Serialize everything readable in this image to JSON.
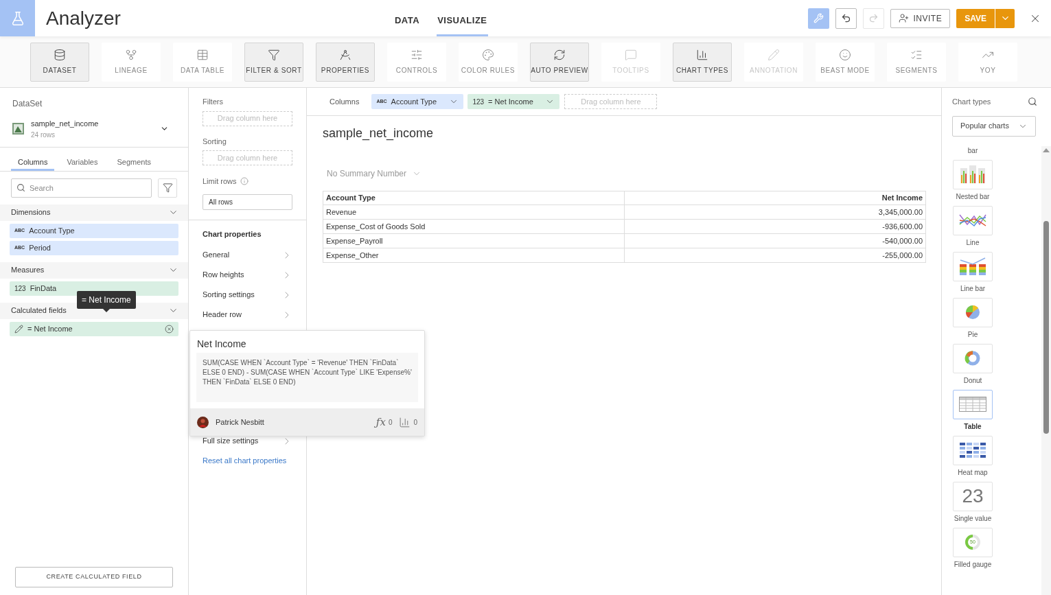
{
  "app": {
    "title": "Analyzer"
  },
  "nav_tabs": [
    {
      "label": "DATA",
      "selected": false
    },
    {
      "label": "VISUALIZE",
      "selected": true
    }
  ],
  "header_actions": {
    "tools_active": true,
    "redo_disabled": true,
    "invite": "INVITE",
    "save": "SAVE"
  },
  "toolbar": [
    {
      "label": "DATASET",
      "active": true,
      "disabled": false
    },
    {
      "label": "LINEAGE",
      "active": false,
      "disabled": false
    },
    {
      "label": "DATA TABLE",
      "active": false,
      "disabled": false
    },
    {
      "label": "FILTER & SORT",
      "active": true,
      "disabled": false
    },
    {
      "label": "PROPERTIES",
      "active": true,
      "disabled": false
    },
    {
      "label": "CONTROLS",
      "active": false,
      "disabled": false
    },
    {
      "label": "COLOR RULES",
      "active": false,
      "disabled": false
    },
    {
      "label": "AUTO PREVIEW",
      "active": true,
      "disabled": false
    },
    {
      "label": "TOOLTIPS",
      "active": false,
      "disabled": true
    },
    {
      "label": "CHART TYPES",
      "active": true,
      "disabled": false
    },
    {
      "label": "ANNOTATION",
      "active": false,
      "disabled": true
    },
    {
      "label": "BEAST MODE",
      "active": false,
      "disabled": false
    },
    {
      "label": "SEGMENTS",
      "active": false,
      "disabled": false
    },
    {
      "label": "YOY",
      "active": false,
      "disabled": false
    }
  ],
  "dataset_panel": {
    "heading": "DataSet",
    "name": "sample_net_income",
    "rows": "24 rows",
    "tabs": [
      {
        "label": "Columns",
        "selected": true
      },
      {
        "label": "Variables",
        "selected": false
      },
      {
        "label": "Segments",
        "selected": false
      }
    ],
    "search": {
      "placeholder": "Search"
    },
    "sections": [
      {
        "title": "Dimensions",
        "items": [
          {
            "kind": "dimension",
            "type_label": "ABC",
            "name": "Account Type"
          },
          {
            "kind": "dimension",
            "type_label": "ABC",
            "name": "Period"
          }
        ]
      },
      {
        "title": "Measures",
        "items": [
          {
            "kind": "measure",
            "type_label": "123",
            "name": "FinData"
          }
        ]
      },
      {
        "title": "Calculated fields",
        "items": [
          {
            "kind": "calculated",
            "name": "= Net Income"
          }
        ]
      }
    ],
    "create_button": "CREATE CALCULATED FIELD"
  },
  "hover_tooltip": "= Net Income",
  "filters_panel": {
    "filters_label": "Filters",
    "filters_drop": "Drag column here",
    "sorting_label": "Sorting",
    "sorting_drop": "Drag column here",
    "limit_label": "Limit rows",
    "limit_value": "All rows",
    "chart_properties_title": "Chart properties",
    "properties": [
      "General",
      "Row heights",
      "Sorting settings",
      "Header row",
      "Full size settings"
    ],
    "reset": "Reset all chart properties"
  },
  "popover": {
    "title": "Net Income",
    "formula": "SUM(CASE WHEN `Account Type` = 'Revenue' THEN `FinData` ELSE 0 END) - SUM(CASE WHEN `Account Type` LIKE 'Expense%' THEN `FinData` ELSE 0 END)",
    "author": "Patrick Nesbitt",
    "function_symbol": "ƒx",
    "formula_count": "0",
    "chart_count": "0"
  },
  "columns_bar": {
    "label": "Columns",
    "pills": [
      {
        "kind": "dimension",
        "type_label": "ABC",
        "name": "Account Type"
      },
      {
        "kind": "measure",
        "type_label": "123",
        "name": "= Net Income"
      }
    ],
    "drop": "Drag column here"
  },
  "chart": {
    "title": "sample_net_income",
    "summary": "No Summary Number",
    "table": {
      "columns": [
        "Account Type",
        "Net Income"
      ],
      "rows": [
        [
          "Revenue",
          "3,345,000.00"
        ],
        [
          "Expense_Cost of Goods Sold",
          "-936,600.00"
        ],
        [
          "Expense_Payroll",
          "-540,000.00"
        ],
        [
          "Expense_Other",
          "-255,000.00"
        ]
      ]
    }
  },
  "chart_types": {
    "title": "Chart types",
    "filter": "Popular charts",
    "partial_label": "bar",
    "items": [
      {
        "kind": "nested_bar",
        "label": "Nested bar",
        "selected": false
      },
      {
        "kind": "line",
        "label": "Line",
        "selected": false
      },
      {
        "kind": "line_bar",
        "label": "Line bar",
        "selected": false
      },
      {
        "kind": "pie",
        "label": "Pie",
        "selected": false
      },
      {
        "kind": "donut",
        "label": "Donut",
        "selected": false
      },
      {
        "kind": "table",
        "label": "Table",
        "selected": true
      },
      {
        "kind": "heat_map",
        "label": "Heat map",
        "selected": false
      },
      {
        "kind": "single_value",
        "label": "Single value",
        "selected": false,
        "icon_text": "23"
      },
      {
        "kind": "gauge",
        "label": "Filled gauge",
        "selected": false,
        "icon_text": "50"
      }
    ]
  }
}
